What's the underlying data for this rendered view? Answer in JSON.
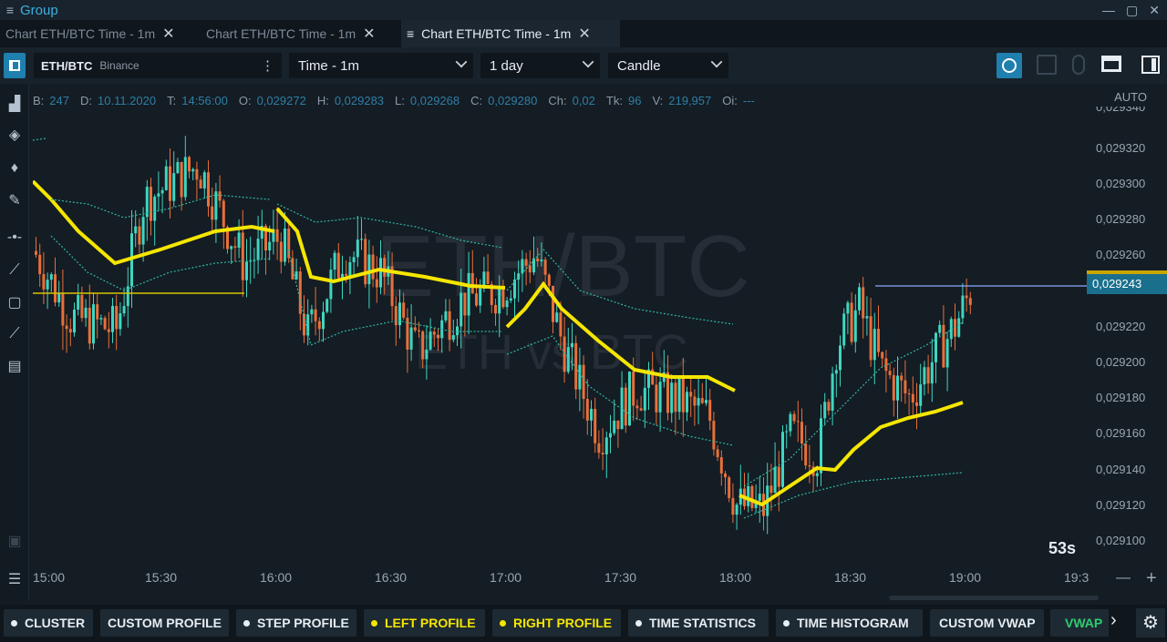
{
  "window": {
    "title": "Group",
    "menu_icon": "≡",
    "controls": [
      "—",
      "▢",
      "✕"
    ]
  },
  "tabs": [
    {
      "label": "Chart ETH/BTC Time - 1m",
      "close": "✕",
      "active": false
    },
    {
      "label": "Chart ETH/BTC Time - 1m",
      "close": "✕",
      "active": false
    },
    {
      "label": "Chart ETH/BTC Time - 1m",
      "close": "✕",
      "active": true,
      "icon": "≡"
    }
  ],
  "toolbar": {
    "symbol": "ETH/BTC",
    "exchange": "Binance",
    "more": "⋮",
    "timeframe": "Time - 1m",
    "range": "1 day",
    "chart_type": "Candle"
  },
  "info": {
    "B": "247",
    "D": "10.11.2020",
    "T": "14:56:00",
    "O": "0,029272",
    "H": "0,029283",
    "L": "0,029268",
    "C": "0,029280",
    "Ch": "0,02",
    "Tk": "96",
    "V": "219,957",
    "Oi": "---"
  },
  "axis": {
    "auto_label": "AUTO",
    "price_ticks": [
      "0,029340",
      "0,029320",
      "0,029300",
      "0,029280",
      "0,029260",
      "0,029220",
      "0,029200",
      "0,029180",
      "0,029160",
      "0,029140",
      "0,029120",
      "0,029100"
    ],
    "current_price": "0,029243",
    "time_ticks": [
      "15:00",
      "15:30",
      "16:00",
      "16:30",
      "17:00",
      "17:30",
      "18:00",
      "18:30",
      "19:00",
      "19:3"
    ],
    "countdown": "53s",
    "zoom_out": "—",
    "zoom_in": "+"
  },
  "watermark": {
    "main": "ETH/BTC",
    "sub": "ETH vs BTC"
  },
  "bottom": {
    "buttons": [
      {
        "label": "CLUSTER",
        "dot": "#e6edf3",
        "color": "#e6edf3"
      },
      {
        "label": "CUSTOM PROFILE",
        "dot": "",
        "color": "#e6edf3"
      },
      {
        "label": "STEP PROFILE",
        "dot": "#e6edf3",
        "color": "#e6edf3"
      },
      {
        "label": "LEFT PROFILE",
        "dot": "#f5e600",
        "color": "#f5e600"
      },
      {
        "label": "RIGHT PROFILE",
        "dot": "#f5e600",
        "color": "#f5e600"
      },
      {
        "label": "TIME STATISTICS",
        "dot": "#e6edf3",
        "color": "#e6edf3"
      },
      {
        "label": "TIME HISTOGRAM",
        "dot": "#e6edf3",
        "color": "#e6edf3"
      },
      {
        "label": "CUSTOM VWAP",
        "dot": "",
        "color": "#e6edf3"
      },
      {
        "label": "VWAP",
        "dot": "#2ecc71",
        "color": "#2ecc71"
      }
    ],
    "scroll_right": "›",
    "settings_icon": "⚙"
  },
  "colors": {
    "up": "#3fd6c0",
    "down": "#e8703a",
    "vwap": "#f5e600",
    "band": "#2fb8a0",
    "accent": "#2a93b8"
  }
}
